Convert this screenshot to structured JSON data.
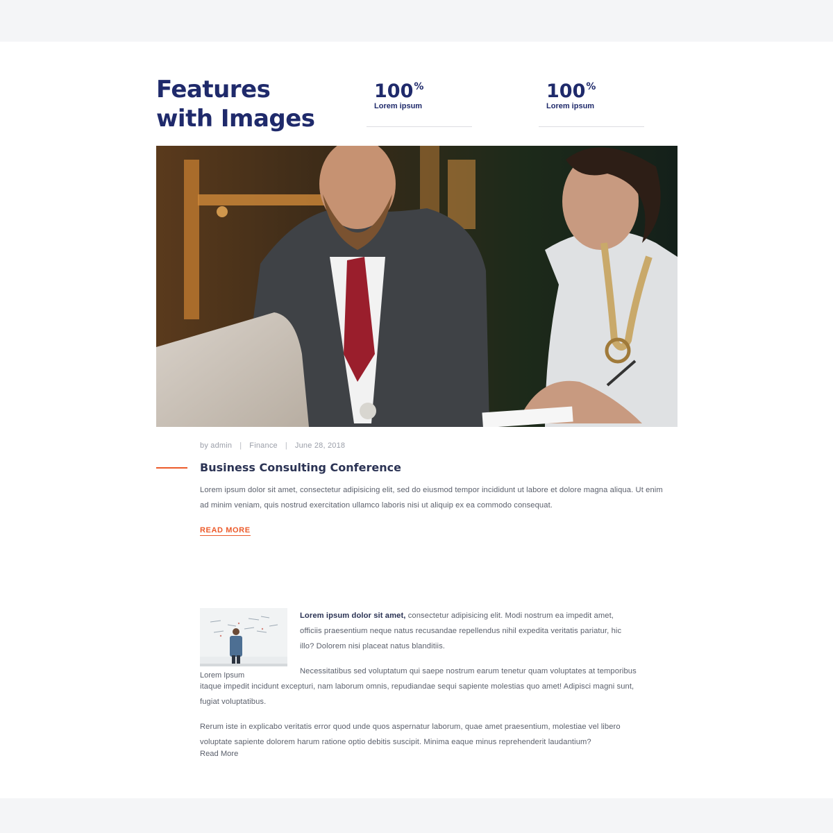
{
  "section": {
    "heading_line1": "Features",
    "heading_line2": "with Images"
  },
  "stats": [
    {
      "value": "100",
      "unit": "%",
      "label": "Lorem ipsum"
    },
    {
      "value": "100",
      "unit": "%",
      "label": "Lorem ipsum"
    }
  ],
  "post": {
    "author": "by admin",
    "category": "Finance",
    "date": "June 28, 2018",
    "title": "Business Consulting Conference",
    "excerpt": "Lorem ipsum dolor sit amet, consectetur adipisicing elit, sed do eiusmod tempor incididunt ut labore et dolore magna aliqua. Ut enim ad minim veniam, quis nostrud exercitation ullamco laboris nisi ut aliquip ex ea commodo consequat.",
    "read_more": "READ MORE"
  },
  "article": {
    "thumb_caption": "Lorem Ipsum",
    "p1_bold": "Lorem ipsum dolor sit amet,",
    "p1_rest": " consectetur adipisicing elit. Modi nostrum ea impedit amet, officiis praesentium neque natus recusandae repellendus nihil expedita veritatis pariatur, hic illo? Dolorem nisi placeat natus blanditiis.",
    "p2": "Necessitatibus sed voluptatum qui saepe nostrum earum tenetur quam voluptates at temporibus itaque impedit incidunt excepturi, nam laborum omnis, repudiandae sequi sapiente molestias quo amet! Adipisci magni sunt, fugiat voluptatibus.",
    "p3": "Rerum iste in explicabo veritatis error quod unde quos aspernatur laborum, quae amet praesentium, molestiae vel libero voluptate sapiente dolorem harum ratione optio debitis suscipit. Minima eaque minus reprehenderit laudantium?",
    "read_more": "Read More"
  },
  "colors": {
    "heading": "#1f2a6b",
    "accent": "#ec5a2a",
    "body_text": "#5a5f6b",
    "page_bg": "#f5f6f8"
  }
}
